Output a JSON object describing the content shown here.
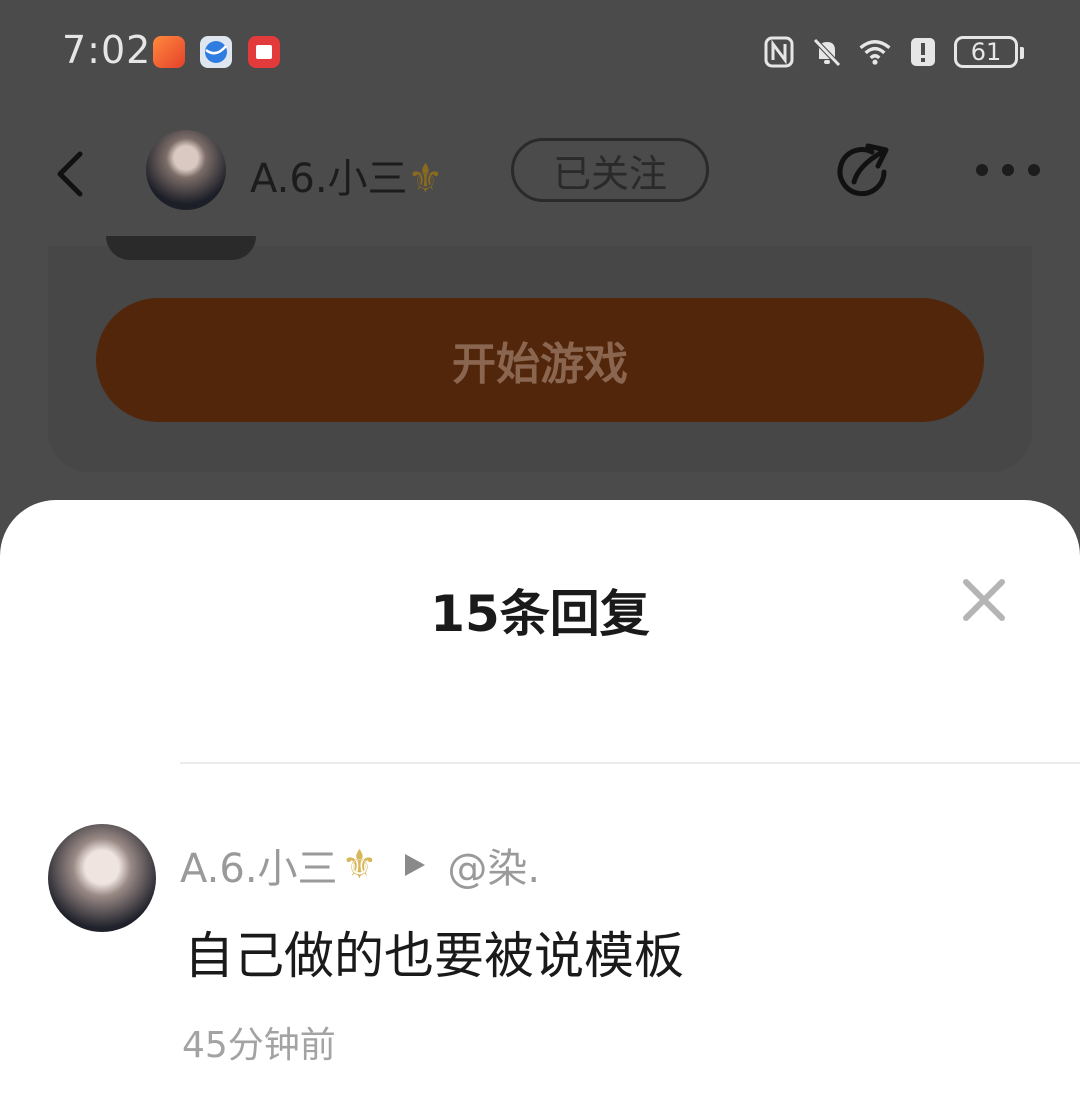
{
  "status_bar": {
    "time": "7:02",
    "battery": "61",
    "icons": [
      "kuaishou-app-icon",
      "browser-app-icon",
      "book-app-icon",
      "nfc-icon",
      "mute-icon",
      "wifi-icon",
      "alert-icon",
      "battery-icon"
    ]
  },
  "header": {
    "username": "A.6.小三",
    "badge_glyph": "⚜",
    "follow_label": "已关注",
    "icons": [
      "back-icon",
      "share-icon",
      "more-icon"
    ]
  },
  "background_card": {
    "start_game_label": "开始游戏"
  },
  "reply_sheet": {
    "title": "15条回复",
    "reply": {
      "author": "A.6.小三",
      "badge_glyph": "⚜",
      "reply_to": "@染.",
      "content": "自己做的也要被说模板",
      "time": "45分钟前"
    }
  },
  "colors": {
    "overlay": "#4b4b4b",
    "start_game_button": "#52260a",
    "sheet_background": "#ffffff",
    "muted_text": "#9a9a9a"
  }
}
